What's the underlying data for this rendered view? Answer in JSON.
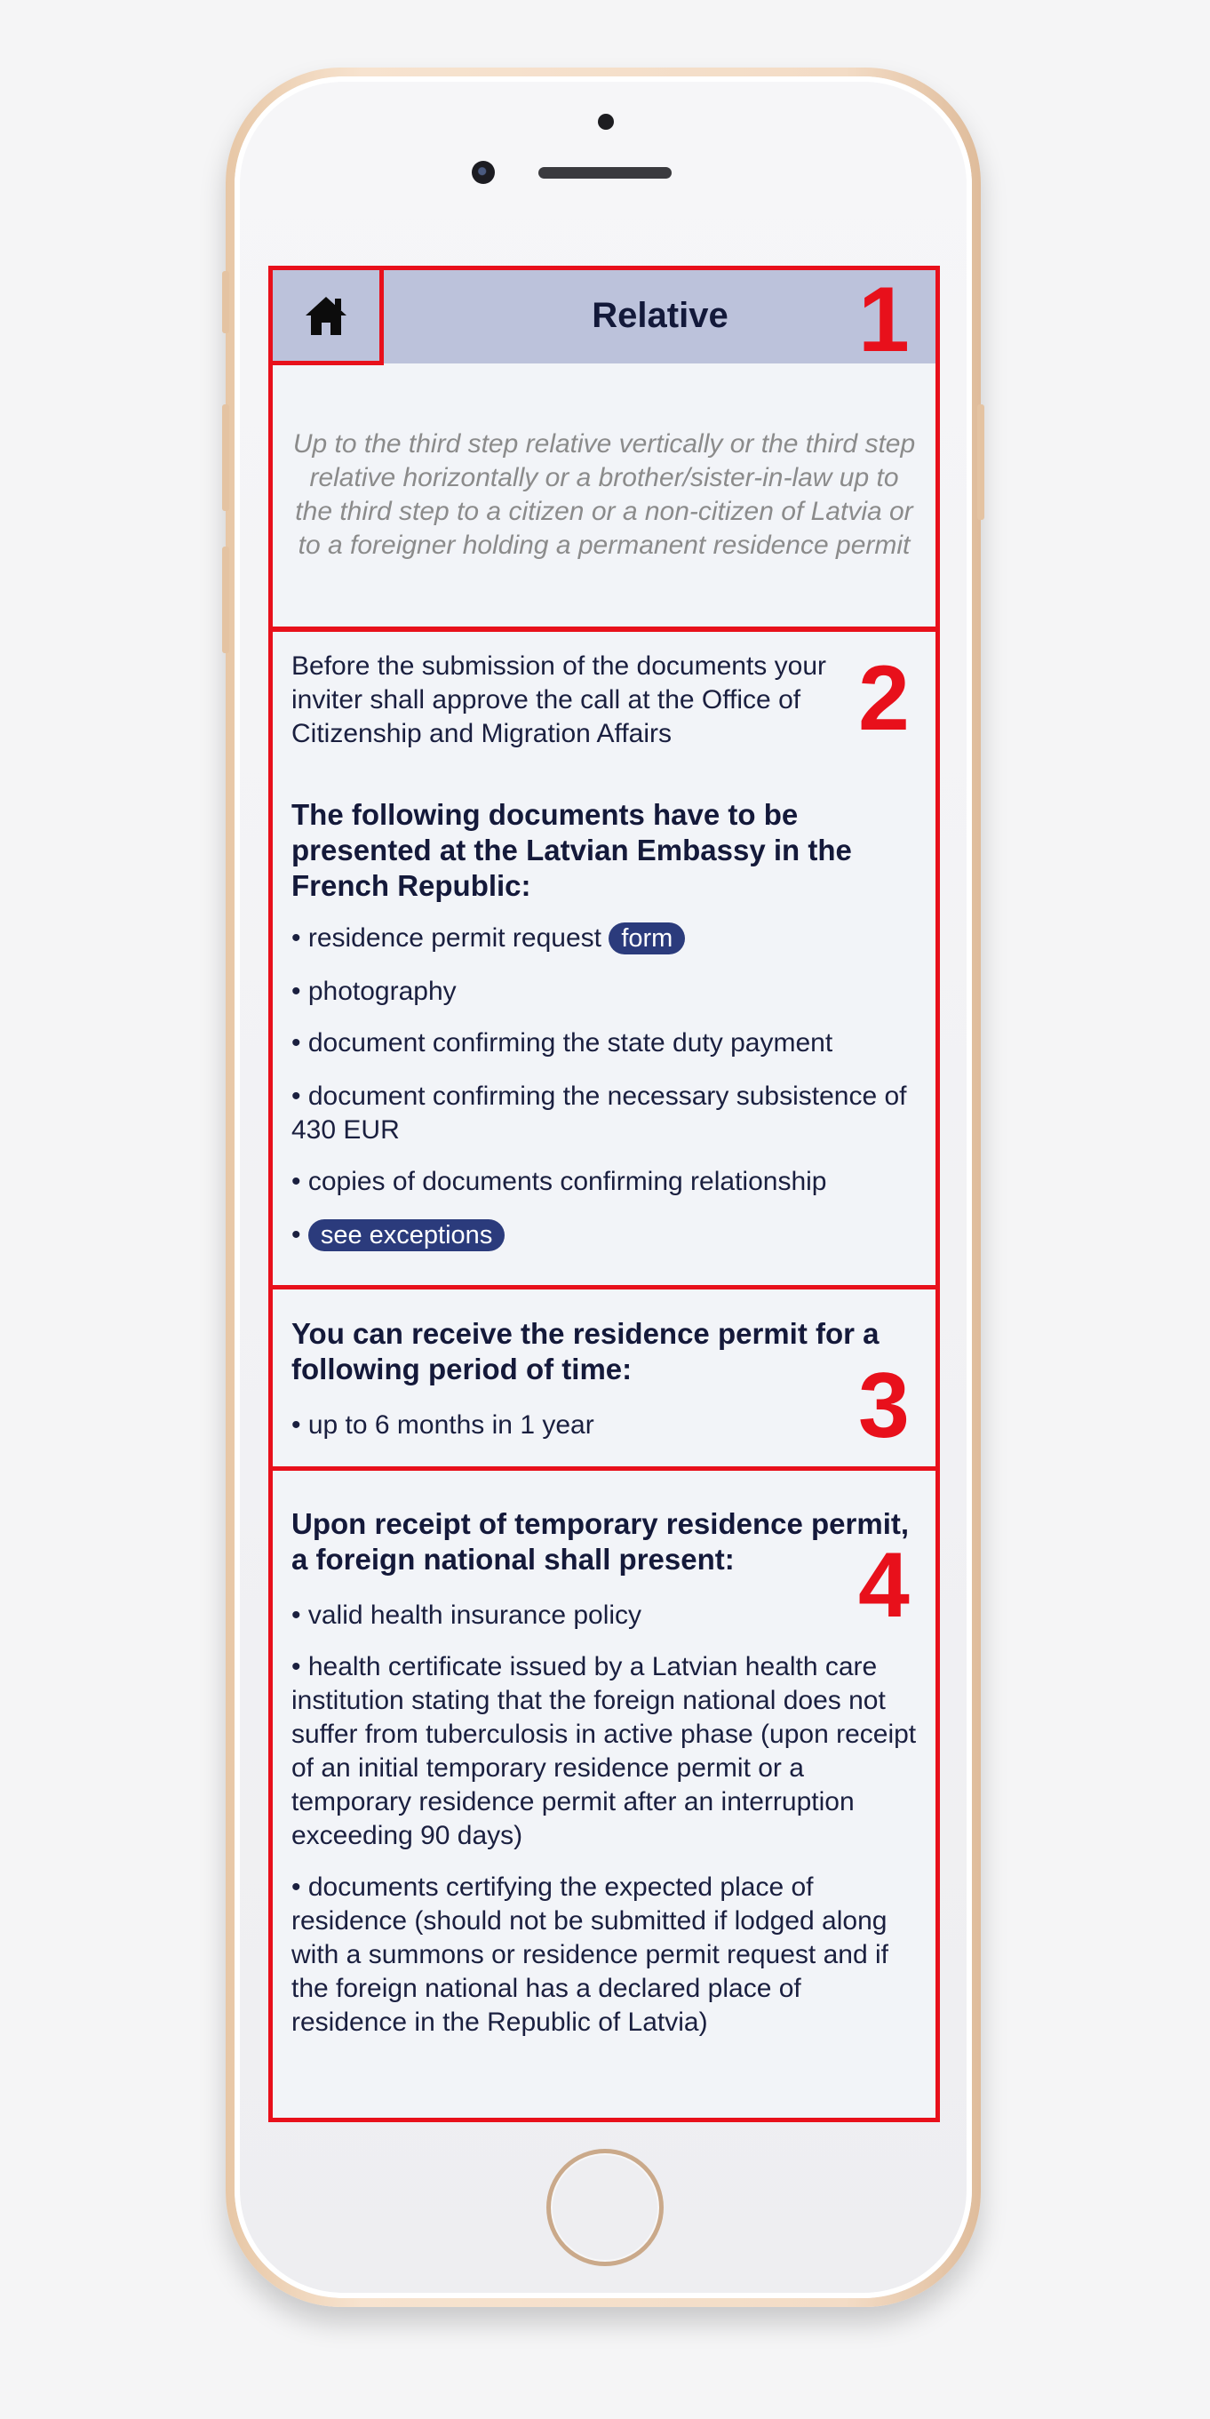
{
  "header": {
    "title": "Relative"
  },
  "intro": "Up to the third step relative vertically or the third step relative horizontally or a brother/sister-in-law up to the third step to a citizen or a non-citizen of Latvia or to a foreigner holding a permanent residence permit",
  "section2": {
    "note": "Before the submission of the documents your inviter shall approve the call at the Office of Citizenship and Migration Affairs",
    "heading": "The following documents have to be presented at the Latvian Embassy in the French Republic:",
    "item1": "• residence permit request",
    "form_link": "form",
    "item2": "• photography",
    "item3": "• document confirming the state duty payment",
    "item4": "• document confirming the necessary subsistence of 430 EUR",
    "item5": "• copies of documents confirming relationship",
    "bullet": "•",
    "exceptions_link": "see exceptions"
  },
  "section3": {
    "heading": "You can receive the residence permit for a following period of time:",
    "item1": "• up to 6 months in 1 year"
  },
  "section4": {
    "heading": "Upon receipt of temporary residence permit, a foreign national shall present:",
    "item1": "• valid health insurance policy",
    "item2": "• health certificate issued by a Latvian health care institution stating that the foreign national does not suffer from tuberculosis in active phase (upon receipt of an initial temporary residence permit or a temporary residence permit after an interruption exceeding 90 days)",
    "item3": "• documents certifying the expected place of residence (should not be submitted if lodged along with a summons or residence permit request and if the foreign national has a declared place of residence in the Republic of Latvia)"
  },
  "annotations": {
    "n1": "1",
    "n2": "2",
    "n3": "3",
    "n4": "4"
  },
  "colors": {
    "accent_red": "#e8101b",
    "header_bg": "#bcc2db",
    "pill_bg": "#2b3b7c",
    "text_dark": "#1a1f3f"
  },
  "icons": {
    "home": "home-icon"
  }
}
